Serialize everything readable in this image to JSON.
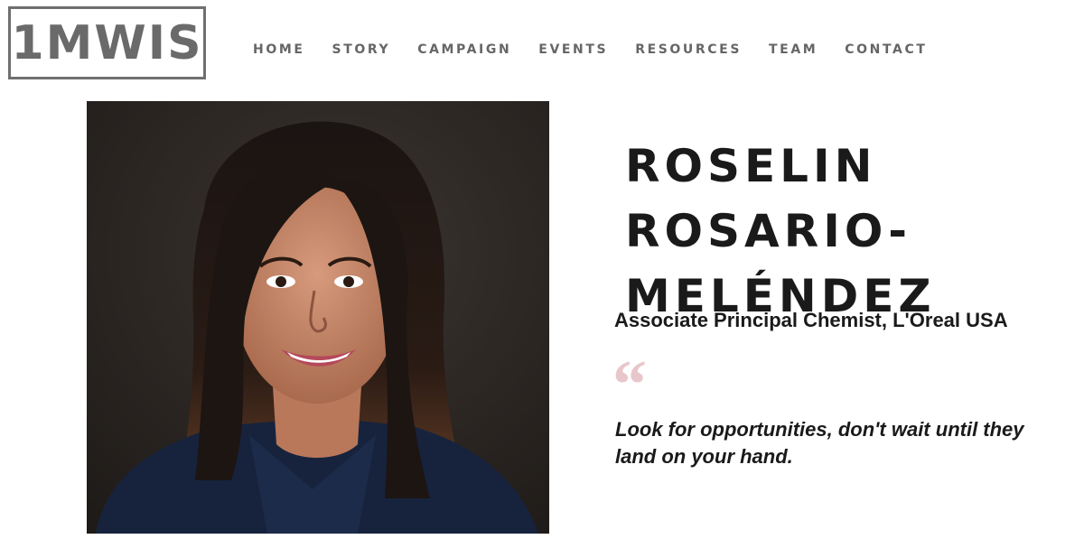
{
  "logo": {
    "text": "1MWIS"
  },
  "nav": {
    "items": [
      {
        "label": "HOME"
      },
      {
        "label": "STORY"
      },
      {
        "label": "CAMPAIGN"
      },
      {
        "label": "EVENTS"
      },
      {
        "label": "RESOURCES"
      },
      {
        "label": "TEAM"
      },
      {
        "label": "CONTACT"
      }
    ]
  },
  "profile": {
    "name_lines": [
      "ROSELIN",
      "ROSARIO-",
      "MELÉNDEZ"
    ],
    "role": "Associate Principal Chemist, L'Oreal USA",
    "quote_mark": "“",
    "quote": "Look for opportunities, don't wait until they land on your hand."
  },
  "colors": {
    "logo_gray": "#6a6a6a",
    "nav_gray": "#666666",
    "heading_black": "#1a1a1a",
    "quote_mark_pink": "#e7c7ca",
    "photo_background": "#2b2622"
  }
}
